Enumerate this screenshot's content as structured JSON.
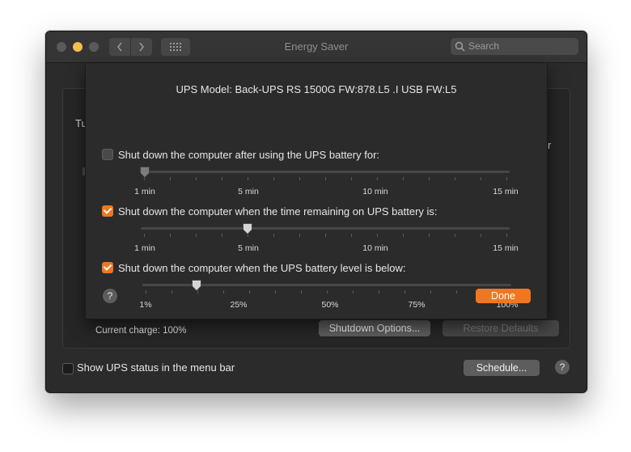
{
  "window": {
    "title": "Energy Saver"
  },
  "search": {
    "placeholder": "Search"
  },
  "background": {
    "stub_left": "Tu",
    "stub_right": "r",
    "current_charge": "Current charge: 100%",
    "shutdown_options_label": "Shutdown Options...",
    "restore_defaults_label": "Restore Defaults",
    "show_status_label": "Show UPS status in the menu bar",
    "show_status_checked": false,
    "schedule_label": "Schedule...",
    "help_label": "?"
  },
  "sheet": {
    "ups_model": "UPS Model:  Back-UPS RS 1500G FW:878.L5 .I USB FW:L5",
    "options": [
      {
        "label": "Shut down the computer after using the UPS battery for:",
        "checked": false,
        "ticks": [
          "1 min",
          "5 min",
          "10 min",
          "15 min"
        ],
        "value": "1 min"
      },
      {
        "label": "Shut down the computer when the time remaining on UPS battery is:",
        "checked": true,
        "ticks": [
          "1 min",
          "5 min",
          "10 min",
          "15 min"
        ],
        "value": "5 min"
      },
      {
        "label": "Shut down the computer when the UPS battery level is below:",
        "checked": true,
        "ticks": [
          "1%",
          "25%",
          "50%",
          "75%",
          "100%"
        ],
        "value": 15
      }
    ],
    "help_label": "?",
    "done_label": "Done"
  },
  "colors": {
    "accent": "#f0771f",
    "window_bg": "#2b2b2b",
    "panel_bg": "#262626"
  },
  "icons": [
    "chevron-left-icon",
    "chevron-right-icon",
    "grid-icon",
    "search-icon",
    "check-icon",
    "slider-knob-icon"
  ]
}
